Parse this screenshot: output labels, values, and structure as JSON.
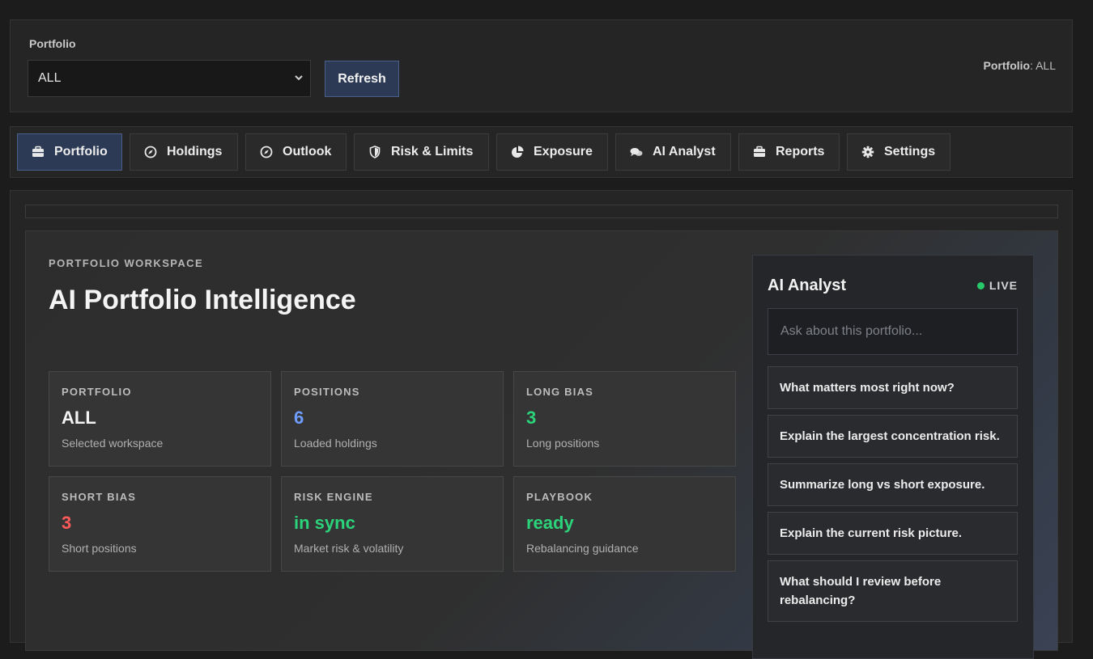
{
  "top": {
    "portfolio_label": "Portfolio",
    "portfolio_value": "ALL",
    "refresh_label": "Refresh",
    "status_key": "Portfolio",
    "status_value": ": ALL"
  },
  "tabs": [
    {
      "label": "Portfolio",
      "icon": "briefcase-icon"
    },
    {
      "label": "Holdings",
      "icon": "compass-icon"
    },
    {
      "label": "Outlook",
      "icon": "compass-icon"
    },
    {
      "label": "Risk & Limits",
      "icon": "shield-icon"
    },
    {
      "label": "Exposure",
      "icon": "pie-chart-icon"
    },
    {
      "label": "AI Analyst",
      "icon": "chat-icon"
    },
    {
      "label": "Reports",
      "icon": "briefcase-icon"
    },
    {
      "label": "Settings",
      "icon": "gear-icon"
    }
  ],
  "workspace": {
    "eyebrow": "PORTFOLIO WORKSPACE",
    "title": "AI Portfolio Intelligence",
    "cards": [
      {
        "key": "PORTFOLIO",
        "value": "ALL",
        "sub": "Selected workspace",
        "color": "#f3f3f3"
      },
      {
        "key": "POSITIONS",
        "value": "6",
        "sub": "Loaded holdings",
        "color": "#6f9cff"
      },
      {
        "key": "LONG BIAS",
        "value": "3",
        "sub": "Long positions",
        "color": "#2bd47a"
      },
      {
        "key": "SHORT BIAS",
        "value": "3",
        "sub": "Short positions",
        "color": "#ff5a5a"
      },
      {
        "key": "RISK ENGINE",
        "value": "in sync",
        "sub": "Market risk & volatility",
        "color": "#2bd47a"
      },
      {
        "key": "PLAYBOOK",
        "value": "ready",
        "sub": "Rebalancing guidance",
        "color": "#2bd47a"
      }
    ]
  },
  "ai": {
    "title": "AI Analyst",
    "live": "LIVE",
    "placeholder": "Ask about this portfolio...",
    "prompts": [
      "What matters most right now?",
      "Explain the largest concentration risk.",
      "Summarize long vs short exposure.",
      "Explain the current risk picture.",
      "What should I review before rebalancing?"
    ]
  },
  "colors": {
    "accent": "#2c3a55",
    "live_dot": "#27c96a"
  }
}
